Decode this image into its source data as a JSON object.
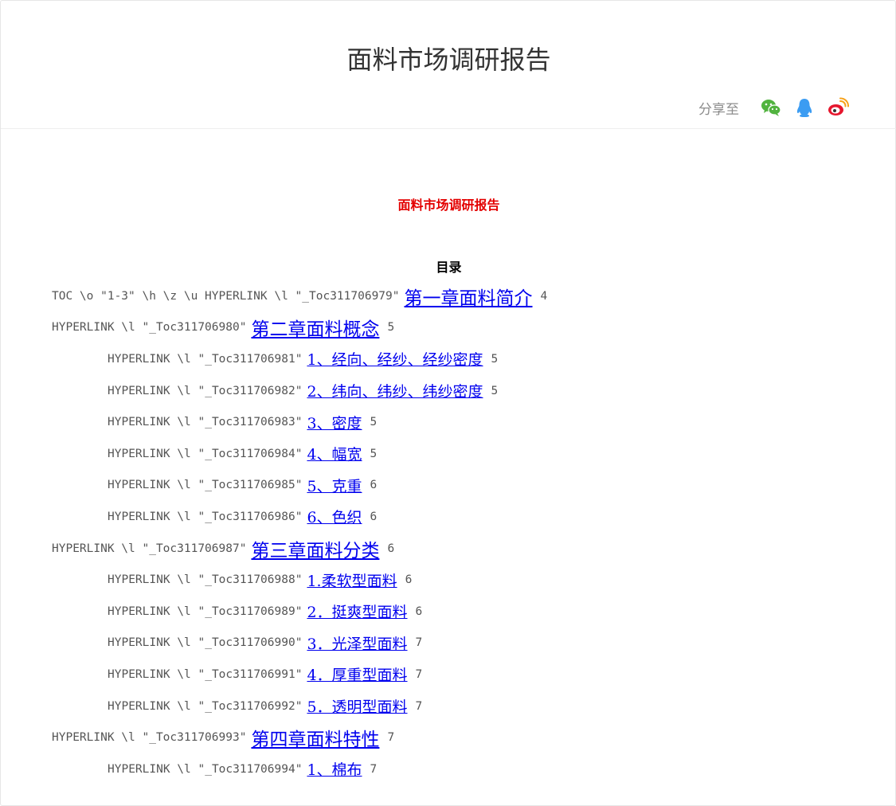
{
  "header": {
    "title": "面料市场调研报告",
    "share_label": "分享至",
    "share_icons": [
      {
        "name": "wechat-icon",
        "color": "#51b33f"
      },
      {
        "name": "qq-icon",
        "color": "#3b9cf2"
      },
      {
        "name": "weibo-icon",
        "color": "#e6162d"
      }
    ]
  },
  "document": {
    "title": "面料市场调研报告",
    "toc_heading": "目录",
    "toc_items": [
      {
        "field": "TOC \\o \"1-3\" \\h \\z \\u HYPERLINK \\l \"_Toc311706979\"",
        "text": "第一章面料简介",
        "page": "4"
      },
      {
        "field": "HYPERLINK \\l \"_Toc311706980\"",
        "text": "第二章面料概念",
        "page": "5"
      },
      {
        "field": "HYPERLINK \\l \"_Toc311706981\"",
        "text": "1、经向、经纱、经纱密度",
        "page": "5"
      },
      {
        "field": "HYPERLINK \\l \"_Toc311706982\"",
        "text": "2、纬向、纬纱、纬纱密度",
        "page": "5"
      },
      {
        "field": "HYPERLINK \\l \"_Toc311706983\"",
        "text": "3、密度",
        "page": "5"
      },
      {
        "field": "HYPERLINK \\l \"_Toc311706984\"",
        "text": "4、幅宽",
        "page": "5"
      },
      {
        "field": "HYPERLINK \\l \"_Toc311706985\"",
        "text": "5、克重",
        "page": "6"
      },
      {
        "field": "HYPERLINK \\l \"_Toc311706986\"",
        "text": "6、色织",
        "page": "6"
      },
      {
        "field": "HYPERLINK \\l \"_Toc311706987\"",
        "text": "第三章面料分类",
        "page": "6"
      },
      {
        "field": "HYPERLINK \\l \"_Toc311706988\"",
        "text": "1.柔软型面料",
        "page": "6"
      },
      {
        "field": "HYPERLINK \\l \"_Toc311706989\"",
        "text": "2．挺爽型面料",
        "page": "6"
      },
      {
        "field": "HYPERLINK \\l \"_Toc311706990\"",
        "text": "3．光泽型面料",
        "page": "7"
      },
      {
        "field": "HYPERLINK \\l \"_Toc311706991\"",
        "text": "4．厚重型面料",
        "page": "7"
      },
      {
        "field": "HYPERLINK \\l \"_Toc311706992\"",
        "text": "5．透明型面料",
        "page": "7"
      },
      {
        "field": "HYPERLINK \\l \"_Toc311706993\"",
        "text": "第四章面料特性",
        "page": "7"
      },
      {
        "field": "HYPERLINK \\l \"_Toc311706994\"",
        "text": "1、棉布",
        "page": "7"
      }
    ]
  }
}
